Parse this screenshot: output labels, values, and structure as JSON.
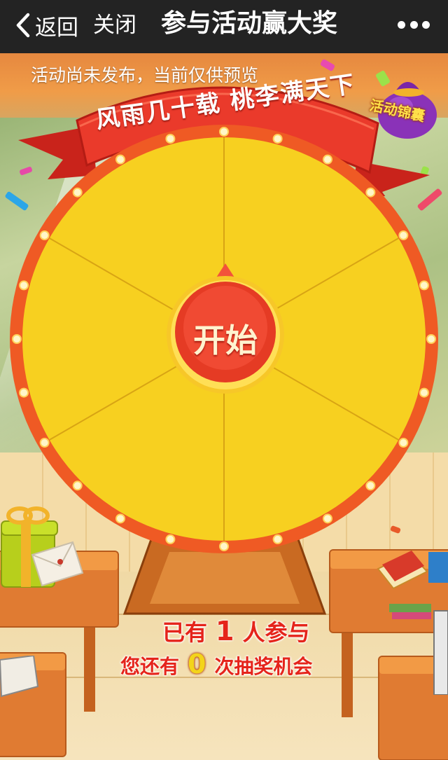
{
  "nav": {
    "back_label": "返回",
    "close_label": "关闭",
    "title": "参与活动赢大奖"
  },
  "notice": "活动尚未发布，当前仅供预览",
  "banner": {
    "text": "风雨几十载 桃李满天下"
  },
  "pouch": {
    "label": "活动锦囊"
  },
  "wheel": {
    "segments": 6,
    "start_label": "开始"
  },
  "stats": {
    "participants_prefix": "已有",
    "participants_count": "1",
    "participants_suffix": "人参与",
    "chances_prefix": "您还有",
    "chances_count": "0",
    "chances_suffix": "次抽奖机会"
  },
  "colors": {
    "nav_bg": "#232323",
    "wheel_face": "#f7d020",
    "wheel_rim": "#ef5a24",
    "button_red": "#e53b24",
    "stats_red": "#e5241b"
  }
}
